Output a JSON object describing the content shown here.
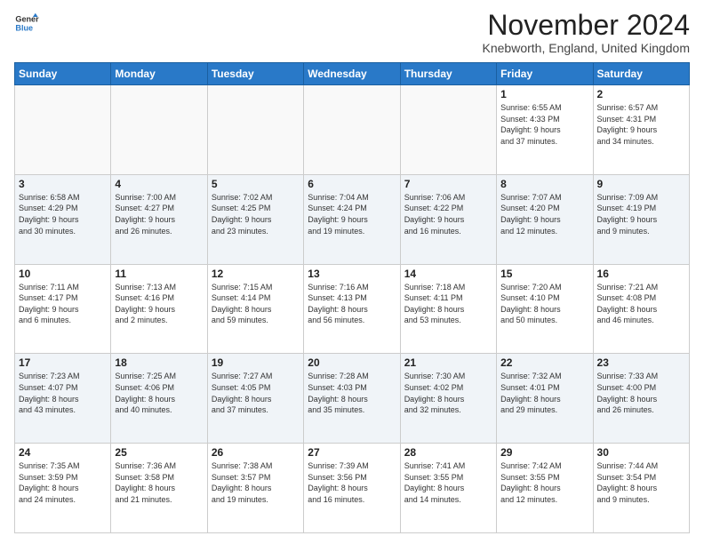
{
  "header": {
    "logo_line1": "General",
    "logo_line2": "Blue",
    "month_title": "November 2024",
    "location": "Knebworth, England, United Kingdom"
  },
  "days_of_week": [
    "Sunday",
    "Monday",
    "Tuesday",
    "Wednesday",
    "Thursday",
    "Friday",
    "Saturday"
  ],
  "weeks": [
    [
      {
        "day": "",
        "info": ""
      },
      {
        "day": "",
        "info": ""
      },
      {
        "day": "",
        "info": ""
      },
      {
        "day": "",
        "info": ""
      },
      {
        "day": "",
        "info": ""
      },
      {
        "day": "1",
        "info": "Sunrise: 6:55 AM\nSunset: 4:33 PM\nDaylight: 9 hours\nand 37 minutes."
      },
      {
        "day": "2",
        "info": "Sunrise: 6:57 AM\nSunset: 4:31 PM\nDaylight: 9 hours\nand 34 minutes."
      }
    ],
    [
      {
        "day": "3",
        "info": "Sunrise: 6:58 AM\nSunset: 4:29 PM\nDaylight: 9 hours\nand 30 minutes."
      },
      {
        "day": "4",
        "info": "Sunrise: 7:00 AM\nSunset: 4:27 PM\nDaylight: 9 hours\nand 26 minutes."
      },
      {
        "day": "5",
        "info": "Sunrise: 7:02 AM\nSunset: 4:25 PM\nDaylight: 9 hours\nand 23 minutes."
      },
      {
        "day": "6",
        "info": "Sunrise: 7:04 AM\nSunset: 4:24 PM\nDaylight: 9 hours\nand 19 minutes."
      },
      {
        "day": "7",
        "info": "Sunrise: 7:06 AM\nSunset: 4:22 PM\nDaylight: 9 hours\nand 16 minutes."
      },
      {
        "day": "8",
        "info": "Sunrise: 7:07 AM\nSunset: 4:20 PM\nDaylight: 9 hours\nand 12 minutes."
      },
      {
        "day": "9",
        "info": "Sunrise: 7:09 AM\nSunset: 4:19 PM\nDaylight: 9 hours\nand 9 minutes."
      }
    ],
    [
      {
        "day": "10",
        "info": "Sunrise: 7:11 AM\nSunset: 4:17 PM\nDaylight: 9 hours\nand 6 minutes."
      },
      {
        "day": "11",
        "info": "Sunrise: 7:13 AM\nSunset: 4:16 PM\nDaylight: 9 hours\nand 2 minutes."
      },
      {
        "day": "12",
        "info": "Sunrise: 7:15 AM\nSunset: 4:14 PM\nDaylight: 8 hours\nand 59 minutes."
      },
      {
        "day": "13",
        "info": "Sunrise: 7:16 AM\nSunset: 4:13 PM\nDaylight: 8 hours\nand 56 minutes."
      },
      {
        "day": "14",
        "info": "Sunrise: 7:18 AM\nSunset: 4:11 PM\nDaylight: 8 hours\nand 53 minutes."
      },
      {
        "day": "15",
        "info": "Sunrise: 7:20 AM\nSunset: 4:10 PM\nDaylight: 8 hours\nand 50 minutes."
      },
      {
        "day": "16",
        "info": "Sunrise: 7:21 AM\nSunset: 4:08 PM\nDaylight: 8 hours\nand 46 minutes."
      }
    ],
    [
      {
        "day": "17",
        "info": "Sunrise: 7:23 AM\nSunset: 4:07 PM\nDaylight: 8 hours\nand 43 minutes."
      },
      {
        "day": "18",
        "info": "Sunrise: 7:25 AM\nSunset: 4:06 PM\nDaylight: 8 hours\nand 40 minutes."
      },
      {
        "day": "19",
        "info": "Sunrise: 7:27 AM\nSunset: 4:05 PM\nDaylight: 8 hours\nand 37 minutes."
      },
      {
        "day": "20",
        "info": "Sunrise: 7:28 AM\nSunset: 4:03 PM\nDaylight: 8 hours\nand 35 minutes."
      },
      {
        "day": "21",
        "info": "Sunrise: 7:30 AM\nSunset: 4:02 PM\nDaylight: 8 hours\nand 32 minutes."
      },
      {
        "day": "22",
        "info": "Sunrise: 7:32 AM\nSunset: 4:01 PM\nDaylight: 8 hours\nand 29 minutes."
      },
      {
        "day": "23",
        "info": "Sunrise: 7:33 AM\nSunset: 4:00 PM\nDaylight: 8 hours\nand 26 minutes."
      }
    ],
    [
      {
        "day": "24",
        "info": "Sunrise: 7:35 AM\nSunset: 3:59 PM\nDaylight: 8 hours\nand 24 minutes."
      },
      {
        "day": "25",
        "info": "Sunrise: 7:36 AM\nSunset: 3:58 PM\nDaylight: 8 hours\nand 21 minutes."
      },
      {
        "day": "26",
        "info": "Sunrise: 7:38 AM\nSunset: 3:57 PM\nDaylight: 8 hours\nand 19 minutes."
      },
      {
        "day": "27",
        "info": "Sunrise: 7:39 AM\nSunset: 3:56 PM\nDaylight: 8 hours\nand 16 minutes."
      },
      {
        "day": "28",
        "info": "Sunrise: 7:41 AM\nSunset: 3:55 PM\nDaylight: 8 hours\nand 14 minutes."
      },
      {
        "day": "29",
        "info": "Sunrise: 7:42 AM\nSunset: 3:55 PM\nDaylight: 8 hours\nand 12 minutes."
      },
      {
        "day": "30",
        "info": "Sunrise: 7:44 AM\nSunset: 3:54 PM\nDaylight: 8 hours\nand 9 minutes."
      }
    ]
  ]
}
